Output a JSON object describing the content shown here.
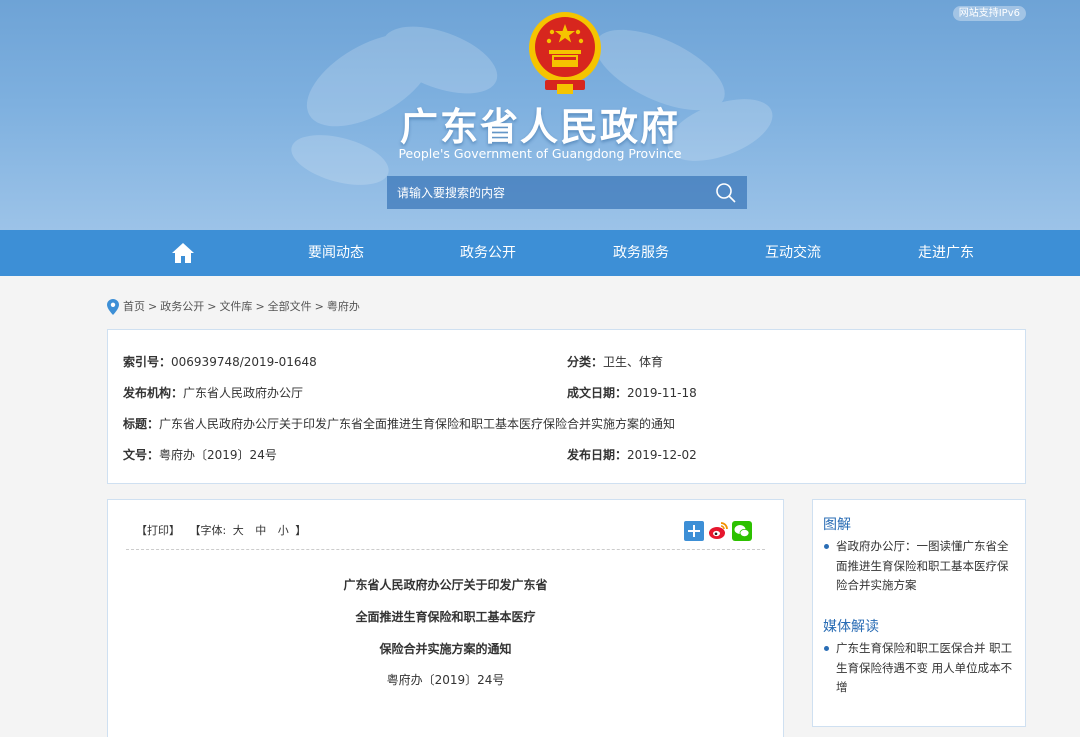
{
  "header": {
    "ipv6_badge": "网站支持IPv6",
    "title": "广东省人民政府",
    "subtitle": "People's Government of Guangdong Province",
    "search_placeholder": "请输入要搜索的内容"
  },
  "nav": {
    "items": [
      "要闻动态",
      "政务公开",
      "政务服务",
      "互动交流",
      "走进广东"
    ]
  },
  "breadcrumb": {
    "items": [
      "首页",
      "政务公开",
      "文件库",
      "全部文件",
      "粤府办"
    ],
    "separator": ">"
  },
  "info": {
    "index_label": "索引号：",
    "index_value": "006939748/2019-01648",
    "category_label": "分类：",
    "category_value": "卫生、体育",
    "issuer_label": "发布机构：",
    "issuer_value": "广东省人民政府办公厅",
    "created_label": "成文日期：",
    "created_value": "2019-11-18",
    "title_label": "标题：",
    "title_value": "广东省人民政府办公厅关于印发广东省全面推进生育保险和职工基本医疗保险合并实施方案的通知",
    "docno_label": "文号：",
    "docno_value": "粤府办〔2019〕24号",
    "published_label": "发布日期：",
    "published_value": "2019-12-02"
  },
  "article": {
    "print_label": "【打印】",
    "font_prefix": "【字体:",
    "font_large": "大",
    "font_medium": "中",
    "font_small": "小",
    "font_suffix": "】",
    "title_lines": [
      "广东省人民政府办公厅关于印发广东省",
      "全面推进生育保险和职工基本医疗",
      "保险合并实施方案的通知"
    ],
    "doc_number": "粤府办〔2019〕24号"
  },
  "sidebar": {
    "section1_title": "图解",
    "section1_items": [
      "省政府办公厅：一图读懂广东省全面推进生育保险和职工基本医疗保险合并实施方案"
    ],
    "section2_title": "媒体解读",
    "section2_items": [
      "广东生育保险和职工医保合并 职工生育保险待遇不变 用人单位成本不增"
    ]
  },
  "colors": {
    "banner": "#7eb0df",
    "nav": "#3d8fd6",
    "accent": "#2a6db5",
    "emblem_red": "#d7261e",
    "emblem_gold": "#f5c400"
  }
}
